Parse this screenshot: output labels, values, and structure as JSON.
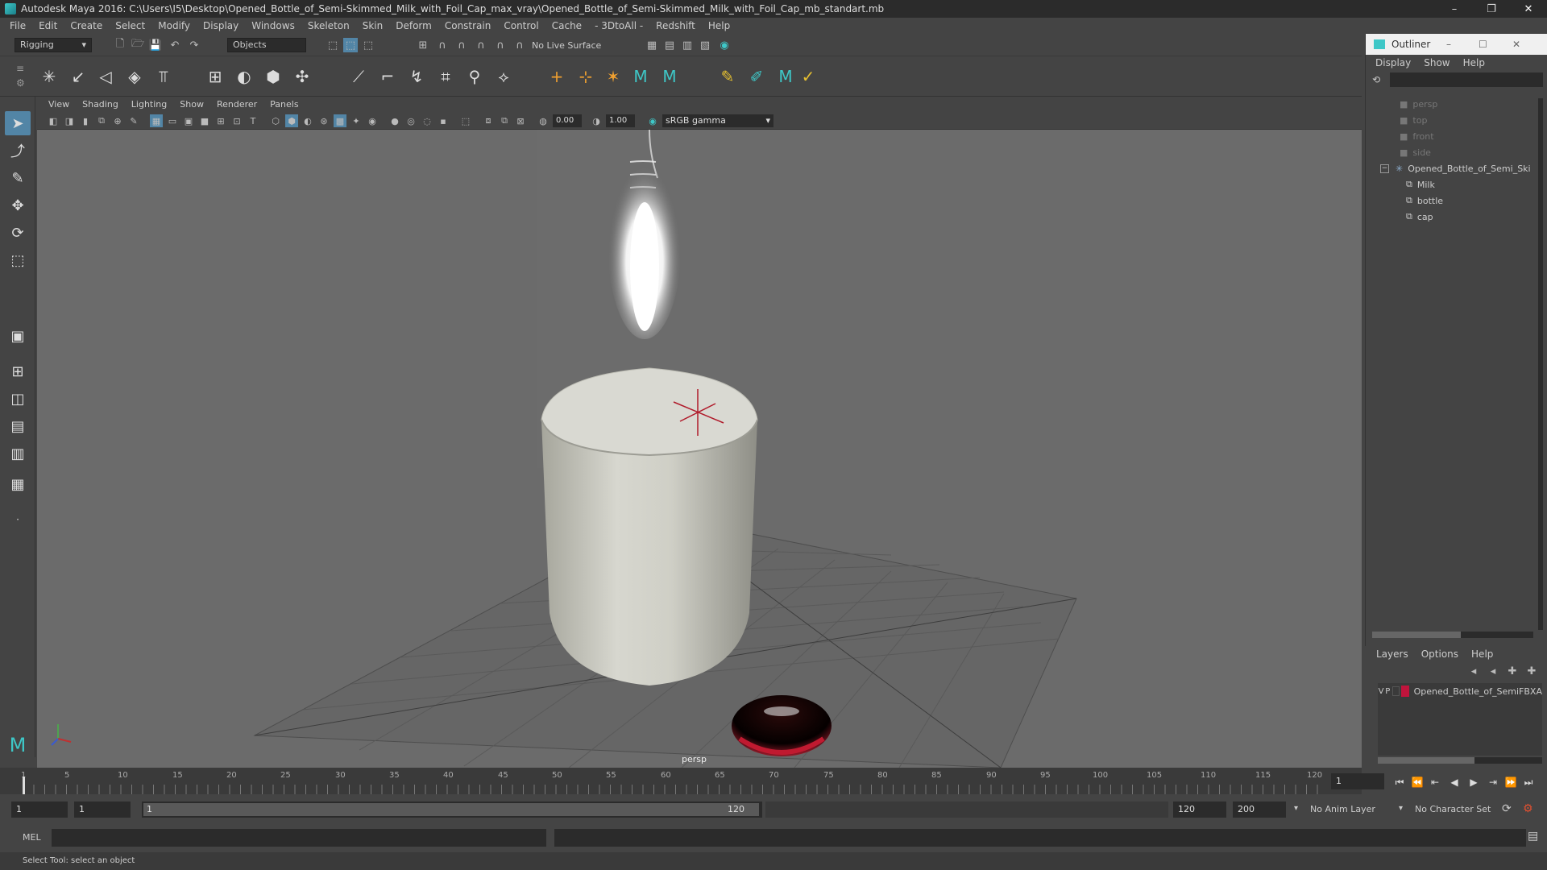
{
  "window": {
    "title": "Autodesk Maya 2016: C:\\Users\\I5\\Desktop\\Opened_Bottle_of_Semi-Skimmed_Milk_with_Foil_Cap_max_vray\\Opened_Bottle_of_Semi-Skimmed_Milk_with_Foil_Cap_mb_standart.mb",
    "minimize": "–",
    "restore": "❐",
    "close": "✕"
  },
  "menu": [
    "File",
    "Edit",
    "Create",
    "Select",
    "Modify",
    "Display",
    "Windows",
    "Skeleton",
    "Skin",
    "Deform",
    "Constrain",
    "Control",
    "Cache",
    "- 3DtoAll -",
    "Redshift",
    "Help"
  ],
  "status_line": {
    "mode": "Rigging",
    "selection_mode": "Objects",
    "live_surface": "No Live Surface"
  },
  "viewport": {
    "menu": [
      "View",
      "Shading",
      "Lighting",
      "Show",
      "Renderer",
      "Panels"
    ],
    "exposure": "0.00",
    "gamma": "1.00",
    "color_space": "sRGB gamma",
    "camera_label": "persp"
  },
  "outliner": {
    "title": "Outliner",
    "menu": [
      "Display",
      "Show",
      "Help"
    ],
    "items": [
      {
        "label": "persp",
        "type": "camera"
      },
      {
        "label": "top",
        "type": "camera"
      },
      {
        "label": "front",
        "type": "camera"
      },
      {
        "label": "side",
        "type": "camera"
      },
      {
        "label": "Opened_Bottle_of_Semi_Ski",
        "type": "group"
      },
      {
        "label": "Milk",
        "type": "mesh"
      },
      {
        "label": "bottle",
        "type": "mesh"
      },
      {
        "label": "cap",
        "type": "mesh"
      }
    ]
  },
  "layers": {
    "menu": [
      "Layers",
      "Options",
      "Help"
    ],
    "layer": {
      "v": "V",
      "p": "P",
      "name": "Opened_Bottle_of_SemiFBXA",
      "color": "#c0143c"
    }
  },
  "timeline": {
    "ticks": [
      "1",
      "5",
      "10",
      "15",
      "20",
      "25",
      "30",
      "35",
      "40",
      "45",
      "50",
      "55",
      "60",
      "65",
      "70",
      "75",
      "80",
      "85",
      "90",
      "95",
      "100",
      "105",
      "110",
      "115",
      "120"
    ],
    "current_frame": "1"
  },
  "range": {
    "start": "1",
    "playback_start": "1",
    "slider_start": "1",
    "slider_end": "120",
    "playback_end": "120",
    "end": "200",
    "anim_layer": "No Anim Layer",
    "character_set": "No Character Set"
  },
  "command_line": {
    "language": "MEL"
  },
  "help_line": "Select Tool: select an object",
  "colors": {
    "accent": "#5285a6",
    "viewport_bg": "#6b6b6b"
  }
}
